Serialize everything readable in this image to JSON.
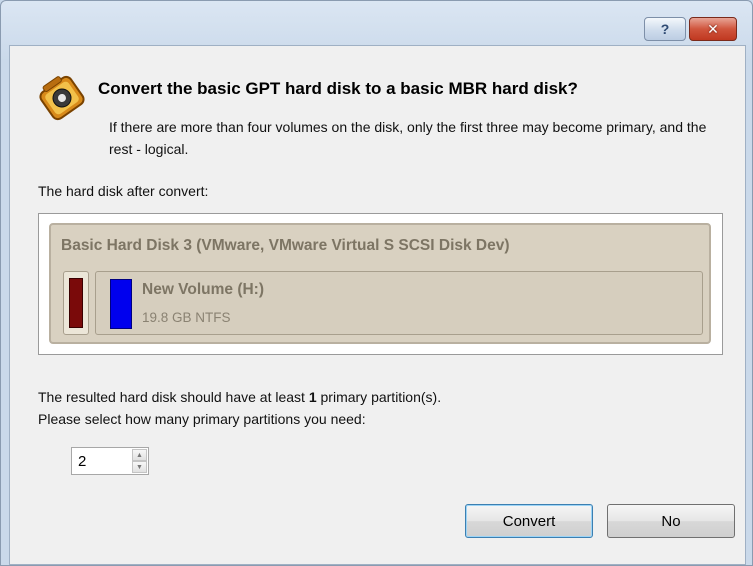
{
  "window": {
    "help_button": "?",
    "close_button": "✕"
  },
  "header": {
    "title": "Convert the basic GPT hard disk to a basic MBR hard disk?",
    "description": "If there are more than four volumes on the disk, only the first three may become primary, and the rest - logical."
  },
  "preview": {
    "section_label": "The hard disk after convert:",
    "disk_title": "Basic Hard Disk 3 (VMware, VMware Virtual S SCSI Disk Dev)",
    "partition": {
      "name": "New Volume (H:)",
      "info": "19.8 GB NTFS",
      "color": "#0000ee"
    },
    "legend_color": "#7a0a0a"
  },
  "requirement": {
    "prefix": "The resulted hard disk should have at least ",
    "count": "1",
    "suffix": " primary partition(s).",
    "prompt": "Please select how many primary partitions you need:"
  },
  "spinner": {
    "value": "2"
  },
  "buttons": {
    "convert": "Convert",
    "no": "No"
  }
}
